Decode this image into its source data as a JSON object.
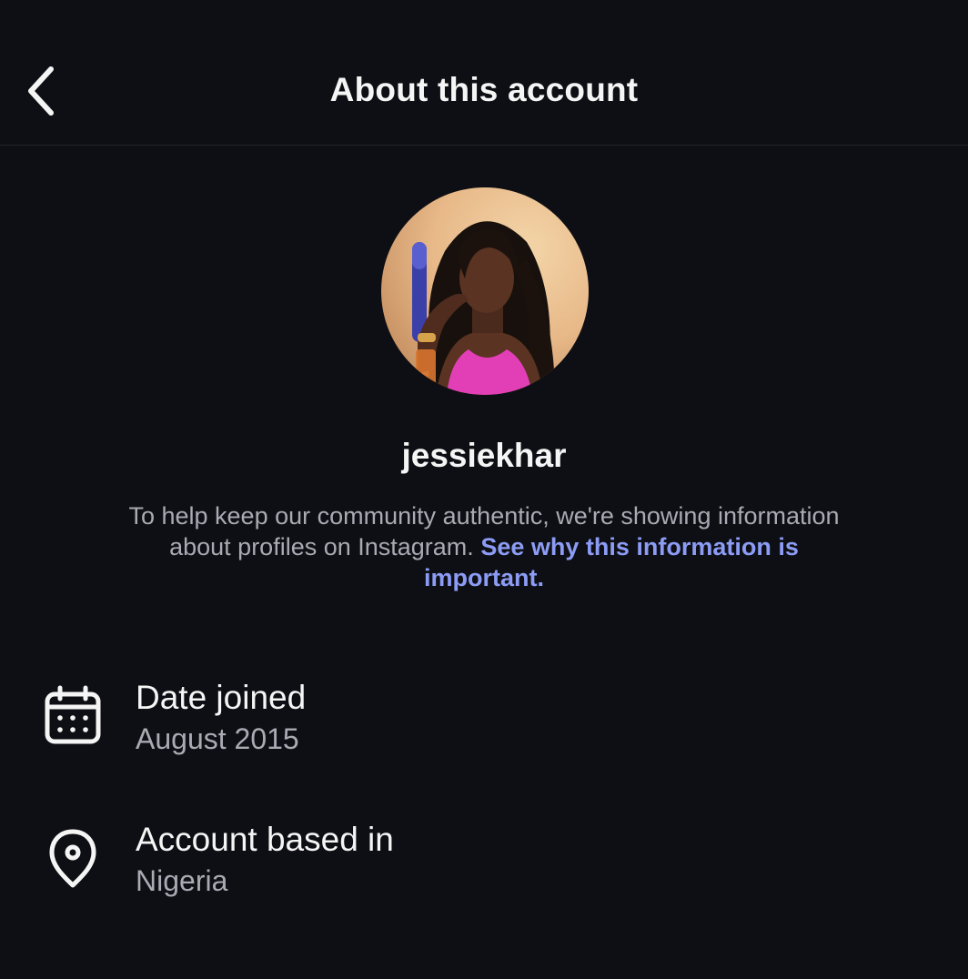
{
  "header": {
    "title": "About this account",
    "back_icon": "chevron-left-icon"
  },
  "profile": {
    "username": "jessiekhar",
    "description_text": "To help keep our community authentic, we're showing information about profiles on Instagram. ",
    "description_link": "See why this information is important.",
    "link_color": "#8c9cf5"
  },
  "info": {
    "date_joined": {
      "icon": "calendar-icon",
      "label": "Date joined",
      "value": "August 2015"
    },
    "account_based_in": {
      "icon": "location-pin-icon",
      "label": "Account based in",
      "value": "Nigeria"
    }
  },
  "colors": {
    "background": "#0e0f14",
    "primary_text": "#f5f5f5",
    "secondary_text": "#a8abb3"
  }
}
